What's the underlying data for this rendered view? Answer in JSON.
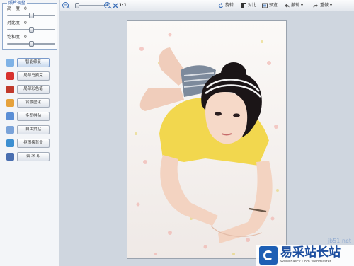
{
  "left_panel": {
    "adjust": {
      "title": "照片调整",
      "sliders": [
        {
          "label": "高　度：0",
          "value": 0.5
        },
        {
          "label": "对比度：0",
          "value": 0.5
        },
        {
          "label": "饱和度：0",
          "value": 0.5
        }
      ]
    },
    "tools": [
      {
        "label": "智能修复",
        "icon": "smart-fix-icon",
        "color": "#7fb2e6",
        "active": true
      },
      {
        "label": "局部马赛克",
        "icon": "heart-icon",
        "color": "#d8322f",
        "active": false
      },
      {
        "label": "局部彩色笔",
        "icon": "shield-icon",
        "color": "#c0392b",
        "active": false
      },
      {
        "label": "背景虚化",
        "icon": "color-wheel-icon",
        "color": "#e6a23c",
        "active": false
      },
      {
        "label": "多图拼贴",
        "icon": "grid-icon",
        "color": "#5b8fd6",
        "active": false
      },
      {
        "label": "自由拼贴",
        "icon": "collage-icon",
        "color": "#7aa3d9",
        "active": false
      },
      {
        "label": "抠图换背景",
        "icon": "landscape-icon",
        "color": "#3d8fd1",
        "active": false
      },
      {
        "label": "去 水 印",
        "icon": "watermark-icon",
        "color": "#4a6fb0",
        "active": false
      }
    ]
  },
  "toolbar": {
    "zoom_out_symbol": "−",
    "zoom_in_symbol": "+",
    "zoom_level": 0.05,
    "ratio_label": "1:1",
    "rotate_label": "旋转",
    "compare_label": "对比",
    "preview_label": "预览",
    "undo_label": "撤销",
    "redo_label": "重做",
    "dropdown_symbol": "▾"
  },
  "watermark": {
    "url": "jb51.net",
    "name": "易采站长站",
    "sub": "Www.Easck.Com Webmaster"
  },
  "colors": {
    "accent": "#3b6fb8",
    "panel_bg": "#f3f5f8",
    "canvas_bg": "#cfd6df",
    "watermark_blue": "#1e5fb4"
  }
}
